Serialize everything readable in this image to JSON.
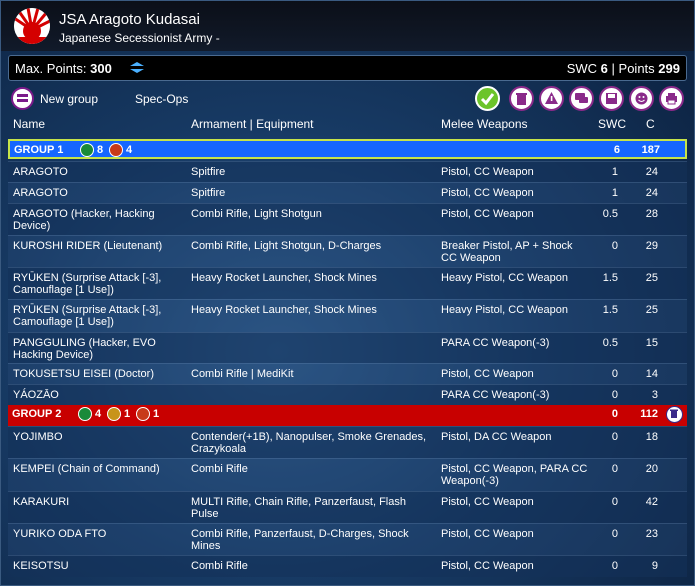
{
  "header": {
    "title": "JSA Aragoto Kudasai",
    "subtitle": "Japanese Secessionist Army -"
  },
  "points_bar": {
    "max_label": "Max. Points:",
    "max_value": "300",
    "swc_label": "SWC",
    "swc_value": "6",
    "separator": "|",
    "points_label": "Points",
    "points_value": "299"
  },
  "toolbar": {
    "new_group": "New group",
    "spec_ops": "Spec-Ops",
    "buttons": [
      "check-icon",
      "trash-icon",
      "warning-icon",
      "chat-icon",
      "save-icon",
      "face-icon",
      "print-icon"
    ]
  },
  "columns": {
    "name": "Name",
    "armament": "Armament | Equipment",
    "melee": "Melee Weapons",
    "swc": "SWC",
    "c": "C"
  },
  "colors": {
    "group1": "#1566ff",
    "group2": "#c80000",
    "regular_order": "#1a8a3a",
    "irregular_order": "#c83a1a",
    "tactical_order": "#c8941a"
  },
  "groups": [
    {
      "label": "GROUP 1",
      "orders": [
        {
          "type": "regular",
          "count": "8"
        },
        {
          "type": "irregular",
          "count": "4"
        }
      ],
      "swc": "6",
      "points": "187",
      "rows": [
        {
          "name": "ARAGOTO",
          "armament": "Spitfire",
          "melee": "Pistol, CC Weapon",
          "swc": "1",
          "c": "24"
        },
        {
          "name": "ARAGOTO",
          "armament": "Spitfire",
          "melee": "Pistol, CC Weapon",
          "swc": "1",
          "c": "24"
        },
        {
          "name": "ARAGOTO (Hacker, Hacking Device)",
          "armament": "Combi Rifle, Light Shotgun",
          "melee": "Pistol, CC Weapon",
          "swc": "0.5",
          "c": "28"
        },
        {
          "name": "KUROSHI RIDER (Lieutenant)",
          "armament": "Combi Rifle, Light Shotgun, D-Charges",
          "melee": "Breaker Pistol, AP + Shock CC Weapon",
          "swc": "0",
          "c": "29"
        },
        {
          "name": "RYŪKEN (Surprise Attack [-3], Camouflage [1 Use])",
          "armament": "Heavy Rocket Launcher, Shock Mines",
          "melee": "Heavy Pistol, CC Weapon",
          "swc": "1.5",
          "c": "25"
        },
        {
          "name": "RYŪKEN (Surprise Attack [-3], Camouflage [1 Use])",
          "armament": "Heavy Rocket Launcher, Shock Mines",
          "melee": "Heavy Pistol, CC Weapon",
          "swc": "1.5",
          "c": "25"
        },
        {
          "name": "PANGGULING (Hacker, EVO Hacking Device)",
          "armament": "",
          "melee": "PARA CC Weapon(-3)",
          "swc": "0.5",
          "c": "15"
        },
        {
          "name": "TOKUSETSU EISEI (Doctor)",
          "armament": "Combi Rifle | MediKit",
          "melee": "Pistol, CC Weapon",
          "swc": "0",
          "c": "14"
        },
        {
          "name": "YÁOZĀO",
          "armament": "",
          "melee": "PARA CC Weapon(-3)",
          "swc": "0",
          "c": "3"
        }
      ]
    },
    {
      "label": "GROUP 2",
      "orders": [
        {
          "type": "regular",
          "count": "4"
        },
        {
          "type": "tactical",
          "count": "1"
        },
        {
          "type": "irregular",
          "count": "1"
        }
      ],
      "swc": "0",
      "points": "112",
      "rows": [
        {
          "name": "YOJIMBO",
          "armament": "Contender(+1B), Nanopulser, Smoke Grenades, Crazykoala",
          "melee": "Pistol, DA CC Weapon",
          "swc": "0",
          "c": "18"
        },
        {
          "name": "KEMPEI (Chain of Command)",
          "armament": "Combi Rifle",
          "melee": "Pistol, CC Weapon, PARA CC Weapon(-3)",
          "swc": "0",
          "c": "20"
        },
        {
          "name": "KARAKURI",
          "armament": "MULTI Rifle, Chain Rifle, Panzerfaust, Flash Pulse",
          "melee": "Pistol, CC Weapon",
          "swc": "0",
          "c": "42"
        },
        {
          "name": "YURIKO ODA FTO",
          "armament": "Combi Rifle, Panzerfaust, D-Charges, Shock Mines",
          "melee": "Pistol, CC Weapon",
          "swc": "0",
          "c": "23"
        },
        {
          "name": "KEISOTSU",
          "armament": "Combi Rifle",
          "melee": "Pistol, CC Weapon",
          "swc": "0",
          "c": "9"
        }
      ]
    }
  ]
}
